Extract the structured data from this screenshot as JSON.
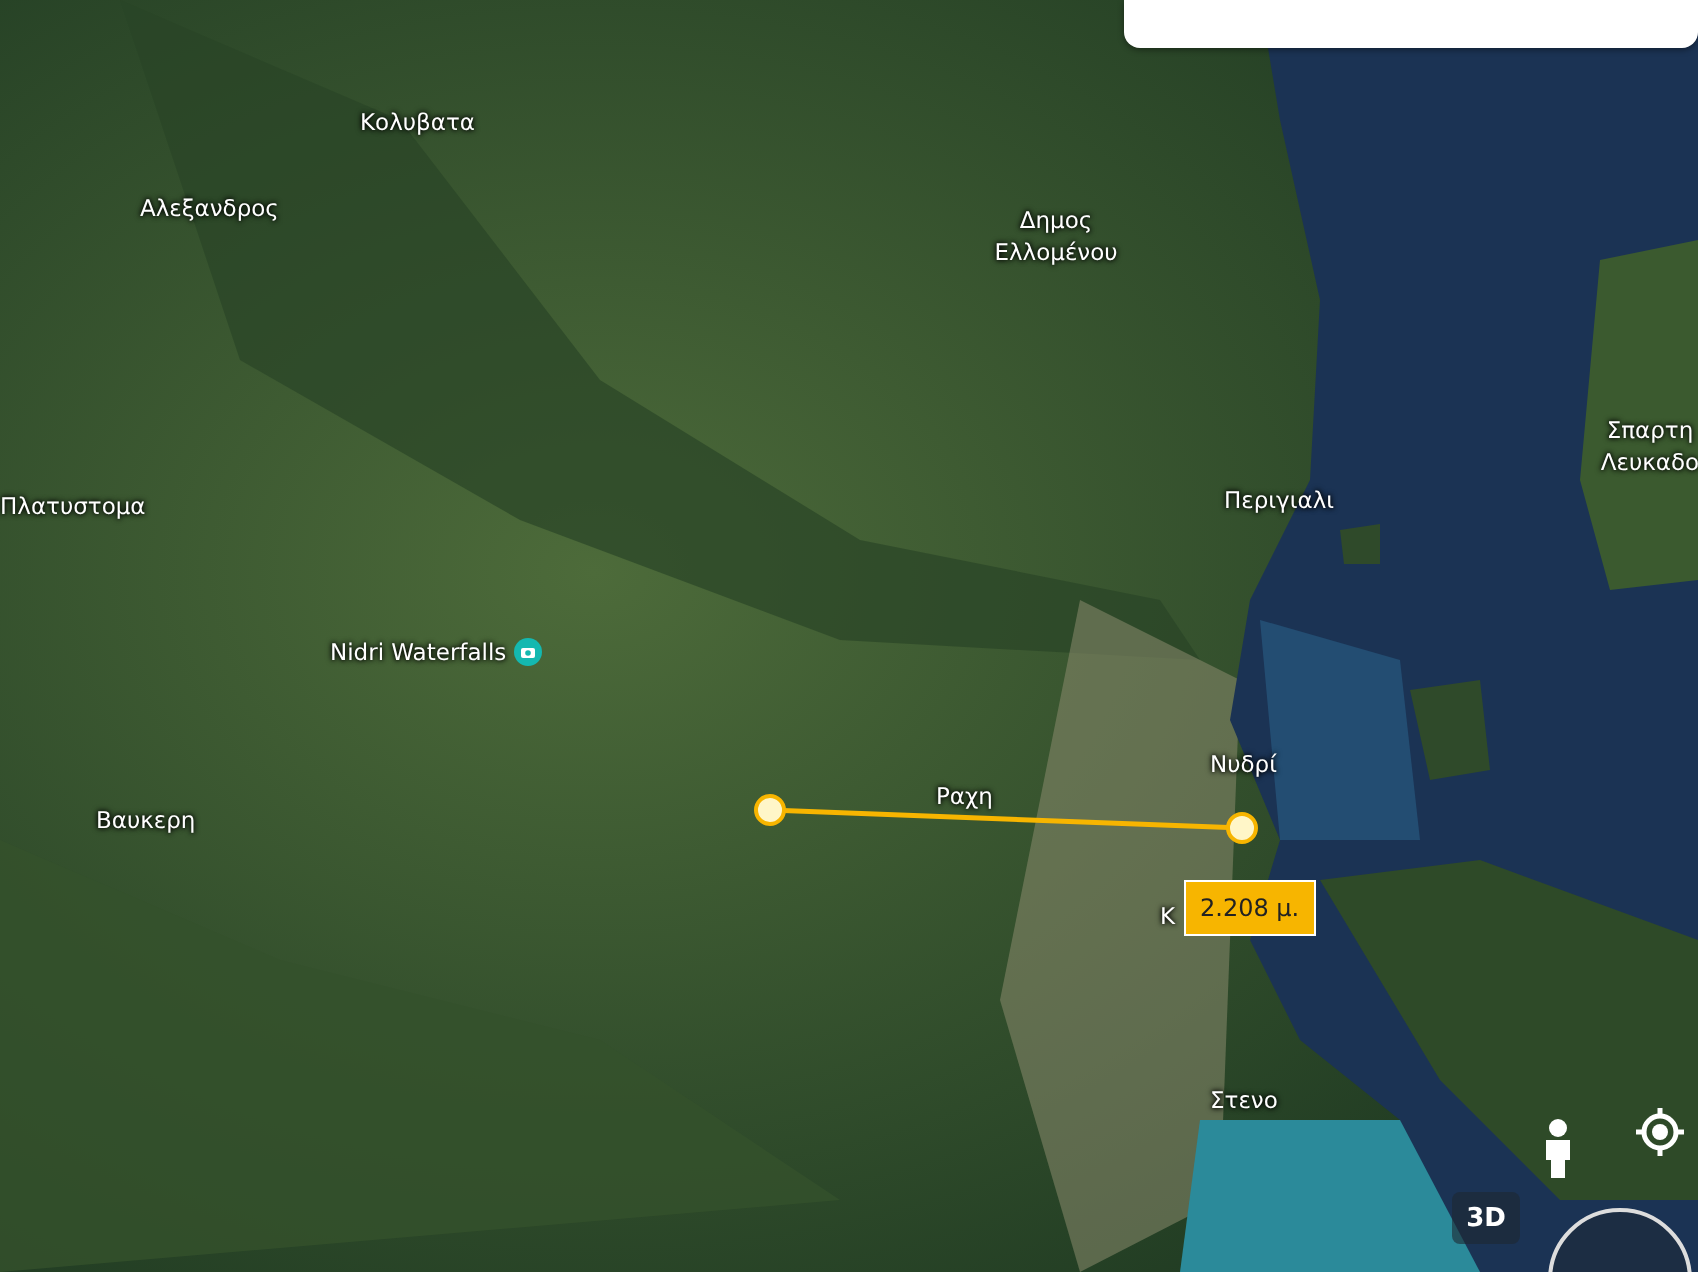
{
  "map": {
    "labels": [
      {
        "text": "Κολυβατα",
        "kind": "place"
      },
      {
        "text": "Αλεξανδρος",
        "kind": "place"
      },
      {
        "text": "Δημος Ελλομένου",
        "kind": "place"
      },
      {
        "text": "Σπαρτη Λευκαδο",
        "kind": "place"
      },
      {
        "text": "Πλατυστομα",
        "kind": "place"
      },
      {
        "text": "Περιγιαλι",
        "kind": "place"
      },
      {
        "text": "Nidri Waterfalls",
        "kind": "poi"
      },
      {
        "text": "Νυδρί",
        "kind": "place"
      },
      {
        "text": "Βαυκερη",
        "kind": "place"
      },
      {
        "text": "Ραχη",
        "kind": "place"
      },
      {
        "text": "Κ",
        "kind": "place"
      },
      {
        "text": "Στενο",
        "kind": "place"
      }
    ]
  },
  "measurement": {
    "distance": "2.208 μ."
  },
  "controls": {
    "view_toggle": "3D"
  }
}
